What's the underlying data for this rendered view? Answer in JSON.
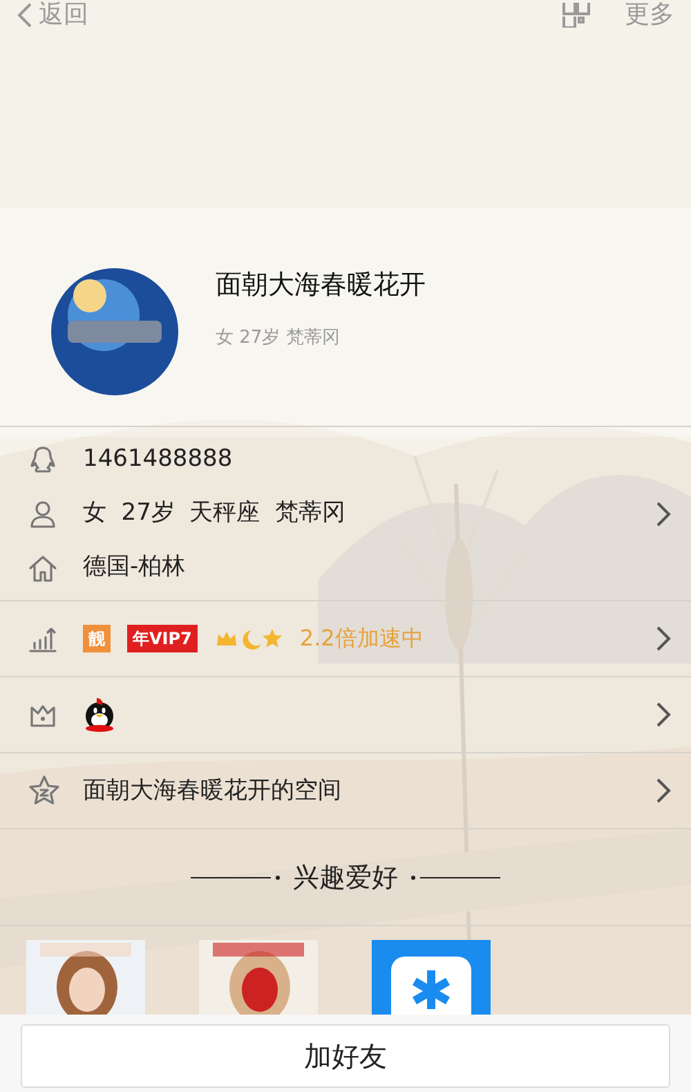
{
  "nav": {
    "back": "返回",
    "more": "更多"
  },
  "profile": {
    "name": "面朝大海春暖花开",
    "subtitle": "女 27岁 梵蒂冈"
  },
  "sections": [
    [
      {
        "kind": "qq",
        "text": "1461488888",
        "arrow": false
      },
      {
        "kind": "person",
        "text": "女  27岁  天秤座  梵蒂冈",
        "arrow": true
      },
      {
        "kind": "home",
        "text": "德国-柏林",
        "arrow": false
      }
    ],
    [
      {
        "kind": "vip",
        "badges": [
          {
            "text": "靓",
            "color": "#f0903a"
          },
          {
            "text": "年VIP7",
            "color": "#e02020"
          }
        ],
        "speed": "2.2倍加速中",
        "arrow": true
      }
    ],
    [
      {
        "kind": "pet",
        "arrow": true
      }
    ],
    [
      {
        "kind": "space",
        "text": "面朝大海春暖花开的空间",
        "arrow": true
      }
    ]
  ],
  "interests": {
    "title": "兴趣爱好",
    "items": [
      {
        "kind": "picture"
      },
      {
        "kind": "picture"
      },
      {
        "kind": "app"
      }
    ]
  },
  "add_friend": "加好友"
}
